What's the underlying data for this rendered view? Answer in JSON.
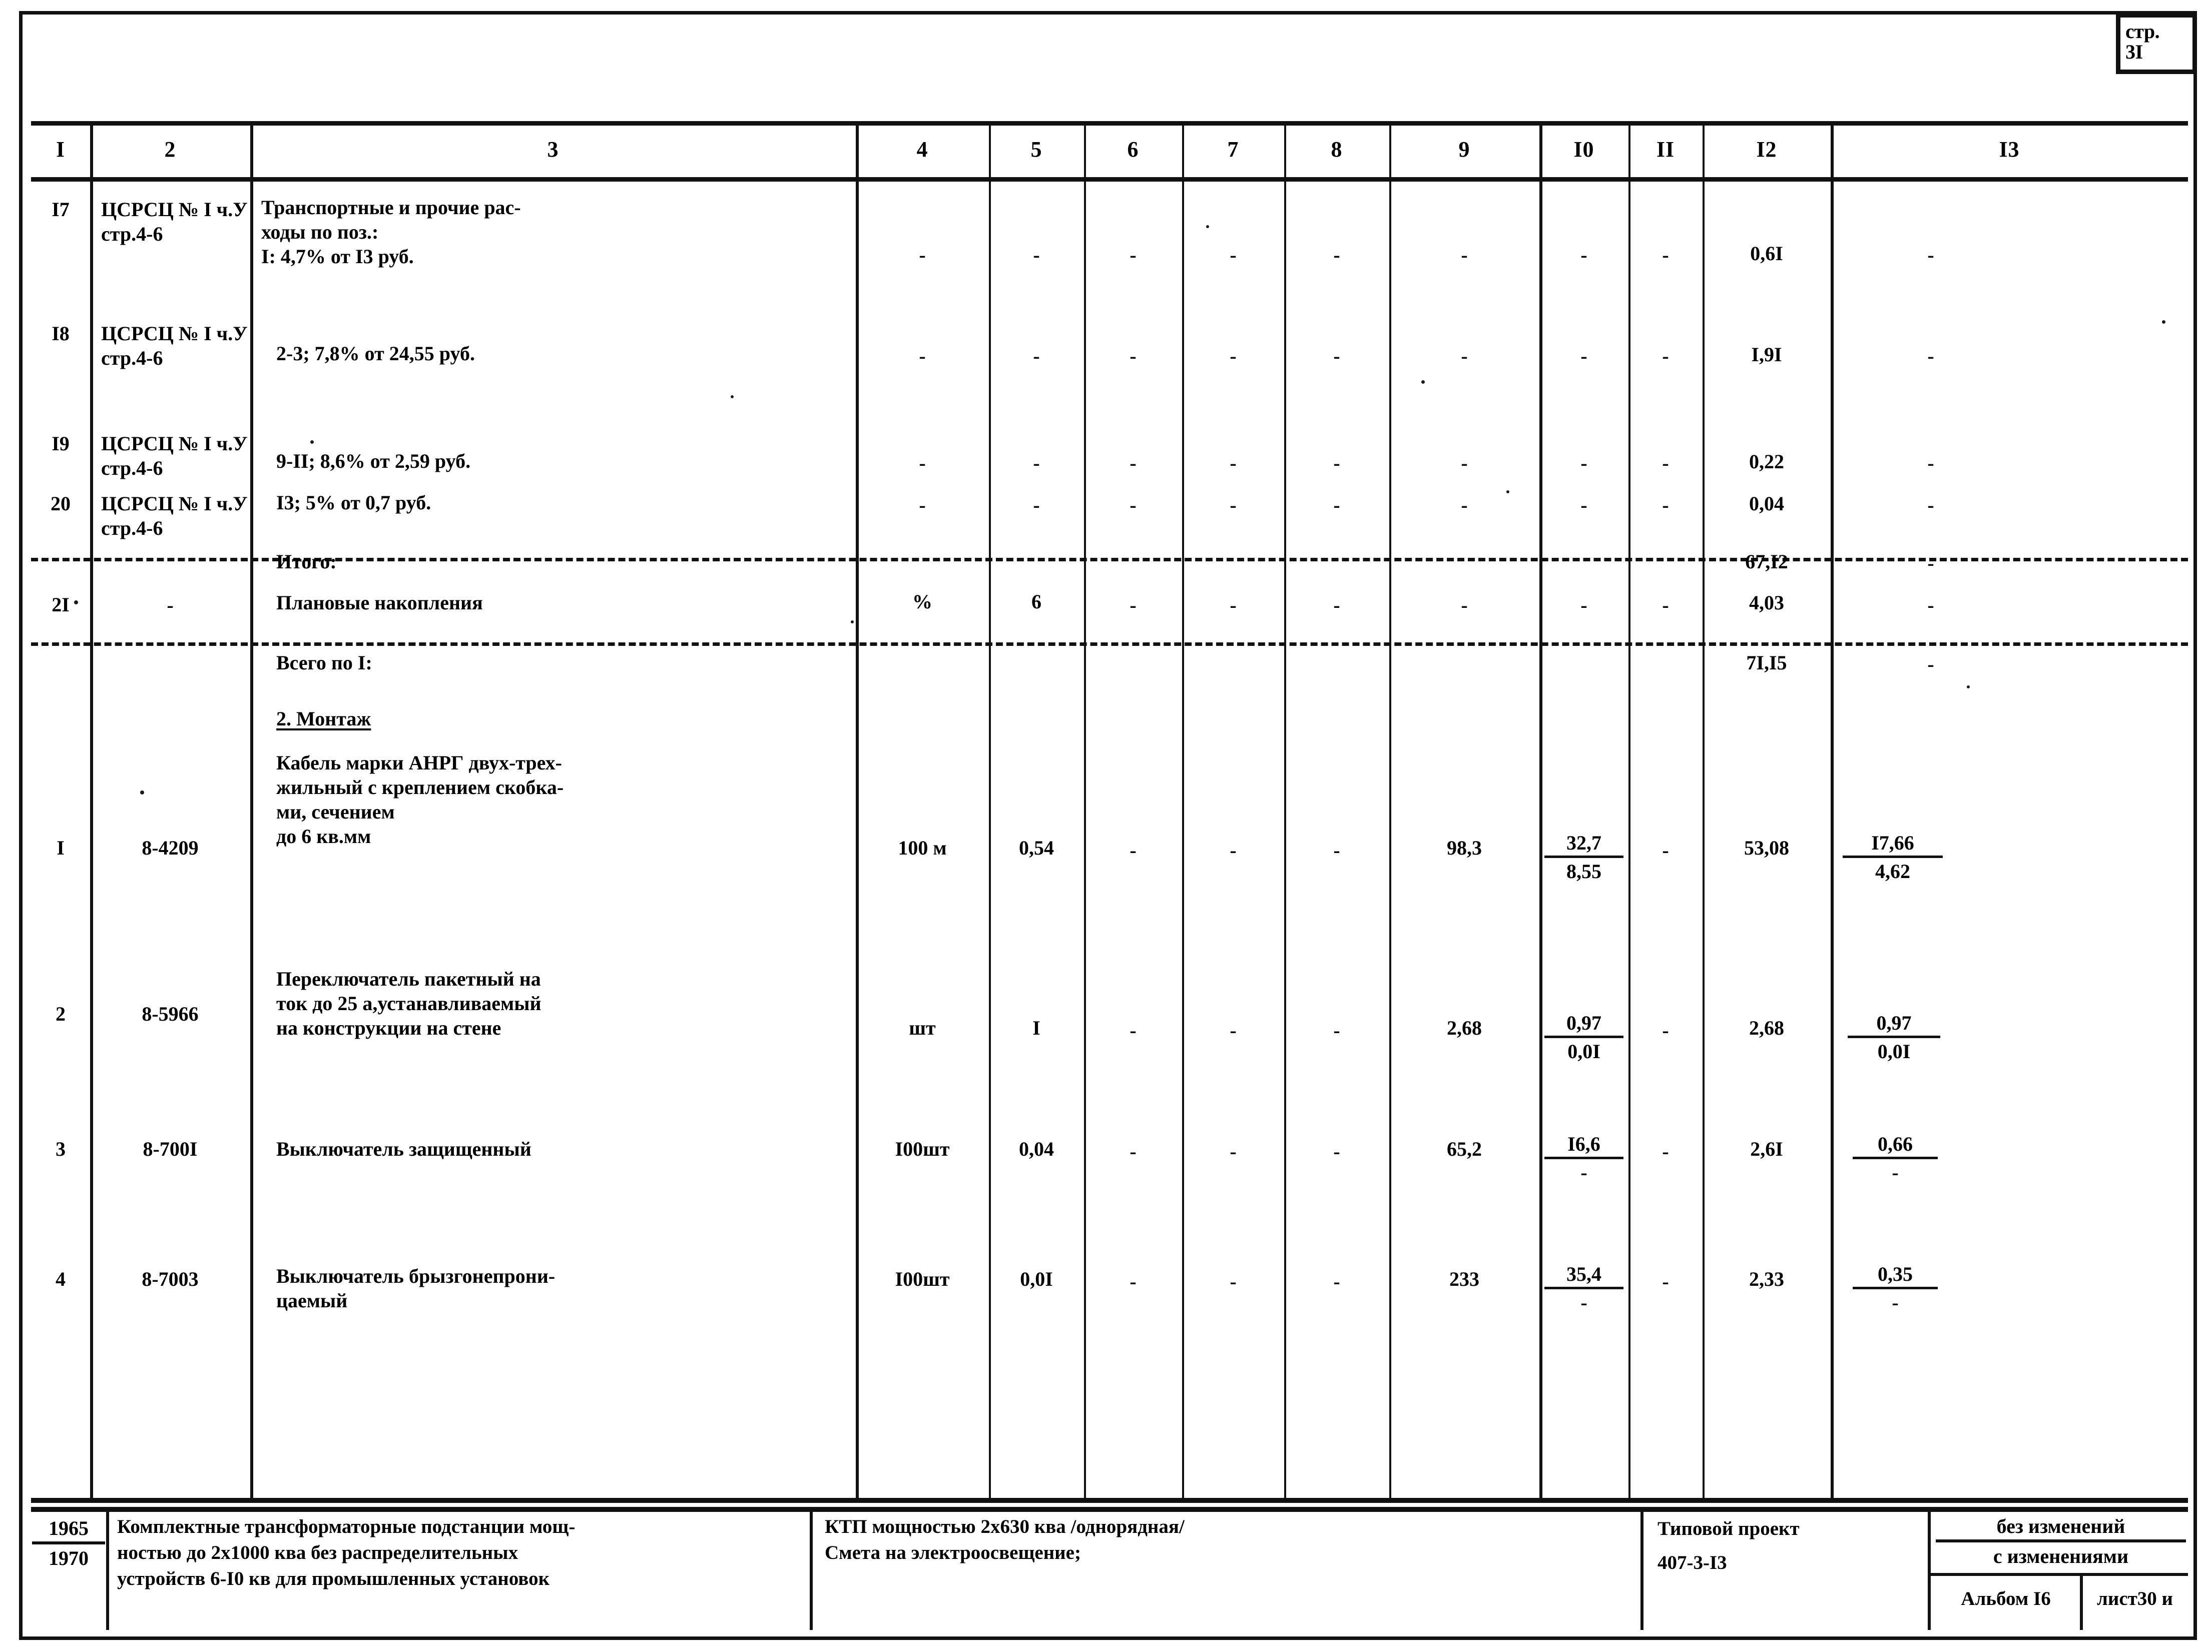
{
  "page_stamp": {
    "line1": "стр.",
    "line2": "3I"
  },
  "table": {
    "headers": [
      "I",
      "2",
      "3",
      "4",
      "5",
      "6",
      "7",
      "8",
      "9",
      "I0",
      "II",
      "I2",
      "I3"
    ],
    "rows": [
      {
        "c1": "I7",
        "c2": "ЦСРСЦ № I ч.У\nстр.4-6",
        "c3": "Транспортные и прочие рас-\nходы по поз.:\nI: 4,7% от I3 руб.",
        "c4": "-",
        "c5": "-",
        "c6": "-",
        "c7": "-",
        "c8": "-",
        "c9": "-",
        "c10": "-",
        "c11": "-",
        "c12": "0,6I",
        "c13": "-"
      },
      {
        "c1": "I8",
        "c2": "ЦСРСЦ № I ч.У\nстр.4-6",
        "c3": "2-3; 7,8% от 24,55 руб.",
        "c4": "-",
        "c5": "-",
        "c6": "-",
        "c7": "-",
        "c8": "-",
        "c9": "-",
        "c10": "-",
        "c11": "-",
        "c12": "I,9I",
        "c13": "-"
      },
      {
        "c1": "I9",
        "c2": "ЦСРСЦ № I ч.У\nстр.4-6",
        "c3": "9-II; 8,6% от 2,59 руб.",
        "c4": "-",
        "c5": "-",
        "c6": "-",
        "c7": "-",
        "c8": "-",
        "c9": "-",
        "c10": "-",
        "c11": "-",
        "c12": "0,22",
        "c13": "-"
      },
      {
        "c1": "20",
        "c2": "ЦСРСЦ № I ч.У\nстр.4-6",
        "c3": "I3; 5% от 0,7 руб.",
        "c4": "-",
        "c5": "-",
        "c6": "-",
        "c7": "-",
        "c8": "-",
        "c9": "-",
        "c10": "-",
        "c11": "-",
        "c12": "0,04",
        "c13": "-"
      },
      {
        "c1": "",
        "c2": "",
        "c3": "Итого:",
        "c4": "",
        "c5": "",
        "c6": "",
        "c7": "",
        "c8": "",
        "c9": "",
        "c10": "",
        "c11": "",
        "c12": "67,I2",
        "c13": "-"
      },
      {
        "c1": "2I",
        "c2": "-",
        "c3": "Плановые накопления",
        "c4": "%",
        "c5": "6",
        "c6": "-",
        "c7": "-",
        "c8": "-",
        "c9": "-",
        "c10": "-",
        "c11": "-",
        "c12": "4,03",
        "c13": "-"
      },
      {
        "c1": "",
        "c2": "",
        "c3": "Всего по I:",
        "c4": "",
        "c5": "",
        "c6": "",
        "c7": "",
        "c8": "",
        "c9": "",
        "c10": "",
        "c11": "",
        "c12": "7I,I5",
        "c13": "-"
      },
      {
        "c1": "",
        "c2": "",
        "c3": "2. Монтаж",
        "c4": "",
        "c5": "",
        "c6": "",
        "c7": "",
        "c8": "",
        "c9": "",
        "c10": "",
        "c11": "",
        "c12": "",
        "c13": ""
      },
      {
        "c1": "I",
        "c2": "8-4209",
        "c3": "Кабель марки АНРГ двух-трех-\nжильный с креплением скобка-\nми, сечением\nдо 6 кв.мм",
        "c4": "100 м",
        "c5": "0,54",
        "c6": "-",
        "c7": "-",
        "c8": "-",
        "c9": "98,3",
        "c10_num": "32,7",
        "c10_den": "8,55",
        "c11": "-",
        "c12": "53,08",
        "c13_num": "I7,66",
        "c13_den": "4,62"
      },
      {
        "c1": "2",
        "c2": "8-5966",
        "c3": "Переключатель пакетный на\nток до 25 а,устанавливаемый\nна конструкции на стене",
        "c4": "шт",
        "c5": "I",
        "c6": "-",
        "c7": "-",
        "c8": "-",
        "c9": "2,68",
        "c10_num": "0,97",
        "c10_den": "0,0I",
        "c11": "-",
        "c12": "2,68",
        "c13_num": "0,97",
        "c13_den": "0,0I"
      },
      {
        "c1": "3",
        "c2": "8-700I",
        "c3": "Выключатель защищенный",
        "c4": "I00шт",
        "c5": "0,04",
        "c6": "-",
        "c7": "-",
        "c8": "-",
        "c9": "65,2",
        "c10_num": "I6,6",
        "c10_den": "-",
        "c11": "-",
        "c12": "2,6I",
        "c13_num": "0,66",
        "c13_den": "-"
      },
      {
        "c1": "4",
        "c2": "8-7003",
        "c3": "Выключатель брызгонепрони-\nцаемый",
        "c4": "I00шт",
        "c5": "0,0I",
        "c6": "-",
        "c7": "-",
        "c8": "-",
        "c9": "233",
        "c10_num": "35,4",
        "c10_den": "-",
        "c11": "-",
        "c12": "2,33",
        "c13_num": "0,35",
        "c13_den": "-"
      }
    ]
  },
  "footer": {
    "years_num": "1965",
    "years_den": "1970",
    "object_title": "Комплектные трансформаторные подстанции мощ-\nностью до 2x1000 ква без распределительных\nустройств 6-I0 кв для промышленных установок",
    "sheet_title": "КТП мощностью 2x630 ква /однорядная/\nСмета на электроосвещение;",
    "project_label": "Типовой проект",
    "project_code": "407-3-I3",
    "changes_num": "без изменений",
    "changes_den": "с изменениями",
    "album": "Альбом I6",
    "list": "лист30 и"
  }
}
